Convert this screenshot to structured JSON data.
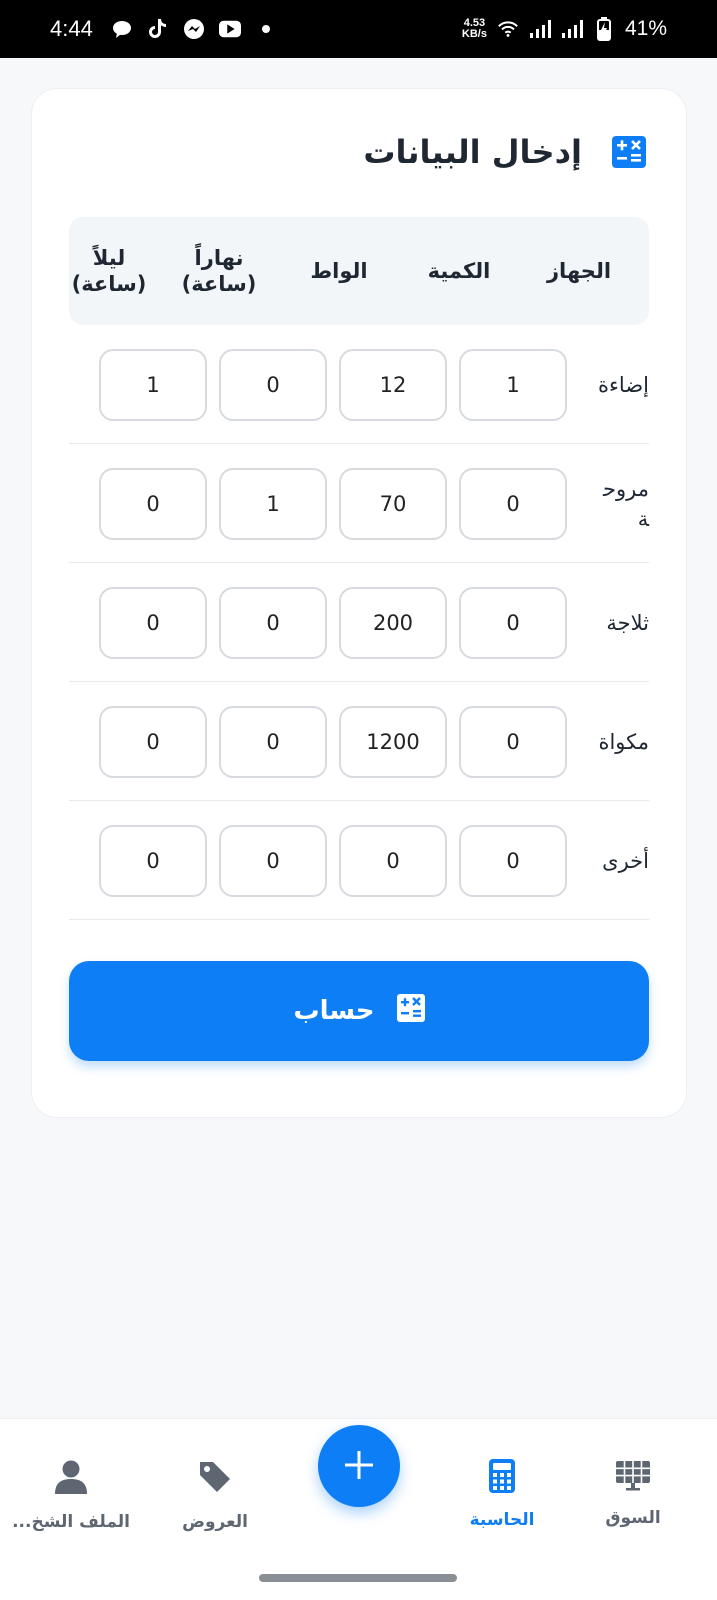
{
  "status_bar": {
    "time": "4:44",
    "net_speed_value": "4.53",
    "net_speed_unit": "KB/s",
    "battery_percent": "41%",
    "notification_icons": [
      "chat-bubble-icon",
      "tiktok-icon",
      "messenger-icon",
      "youtube-icon",
      "dot-icon"
    ]
  },
  "card": {
    "title": "إدخال البيانات",
    "headers": {
      "device": "الجهاز",
      "quantity": "الكمية",
      "watt": "الواط",
      "day_line1": "نهاراً",
      "day_line2": "(ساعة)",
      "night_line1": "ليلاً",
      "night_line2": "(ساعة)"
    },
    "rows": [
      {
        "label": "إضاءة",
        "quantity": "1",
        "watt": "12",
        "day": "0",
        "night": "1"
      },
      {
        "label": "مروحة",
        "quantity": "0",
        "watt": "70",
        "day": "1",
        "night": "0"
      },
      {
        "label": "ثلاجة",
        "quantity": "0",
        "watt": "200",
        "day": "0",
        "night": "0"
      },
      {
        "label": "مكواة",
        "quantity": "0",
        "watt": "1200",
        "day": "0",
        "night": "0"
      },
      {
        "label": "أخرى",
        "quantity": "0",
        "watt": "0",
        "day": "0",
        "night": "0"
      }
    ],
    "calculate_label": "حساب"
  },
  "bottom_nav": {
    "market": "السوق",
    "calculator": "الحاسبة",
    "offers": "العروض",
    "profile": "الملف الشخ..."
  },
  "colors": {
    "accent": "#0d7ef5",
    "background": "#f6f8fa",
    "header_bg": "#f3f6f9",
    "nav_inactive": "#5e6672"
  }
}
